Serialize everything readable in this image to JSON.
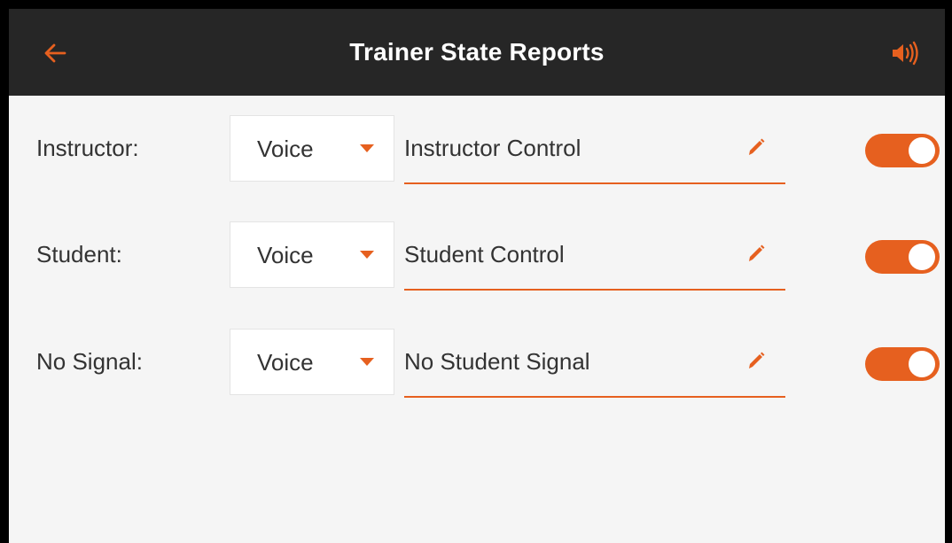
{
  "header": {
    "title": "Trainer State Reports",
    "back_icon": "back-arrow-icon",
    "sound_icon": "speaker-icon"
  },
  "accent_color": "#e6601f",
  "rows": [
    {
      "label": "Instructor:",
      "mode": "Voice",
      "text": "Instructor Control",
      "enabled": true
    },
    {
      "label": "Student:",
      "mode": "Voice",
      "text": "Student Control",
      "enabled": true
    },
    {
      "label": "No Signal:",
      "mode": "Voice",
      "text": "No Student Signal",
      "enabled": true
    }
  ]
}
